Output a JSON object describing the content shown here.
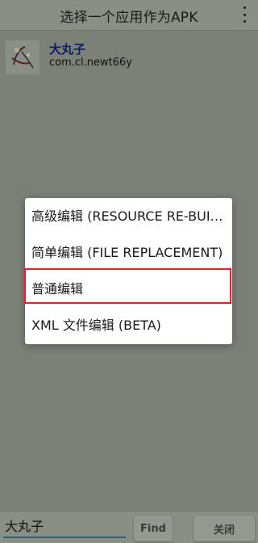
{
  "header": {
    "title": "选择一个应用作为APK",
    "menu_icon": "overflow-menu-icon"
  },
  "app": {
    "name": "大丸子",
    "package": "com.cl.newt66y",
    "icon": "app-logo-icon"
  },
  "dialog": {
    "options": [
      "高级编辑 (RESOURCE RE-BUILD)",
      "简单编辑 (FILE REPLACEMENT)",
      "普通编辑",
      "XML 文件编辑 (BETA)"
    ],
    "highlight_color": "#e0212e"
  },
  "bottom": {
    "search_value": "大丸子",
    "find_label": "Find",
    "close_label": "关闭"
  },
  "colors": {
    "overlay_bg": "#7c8178",
    "dialog_bg": "#ffffff",
    "app_name": "#0c1a6b"
  }
}
